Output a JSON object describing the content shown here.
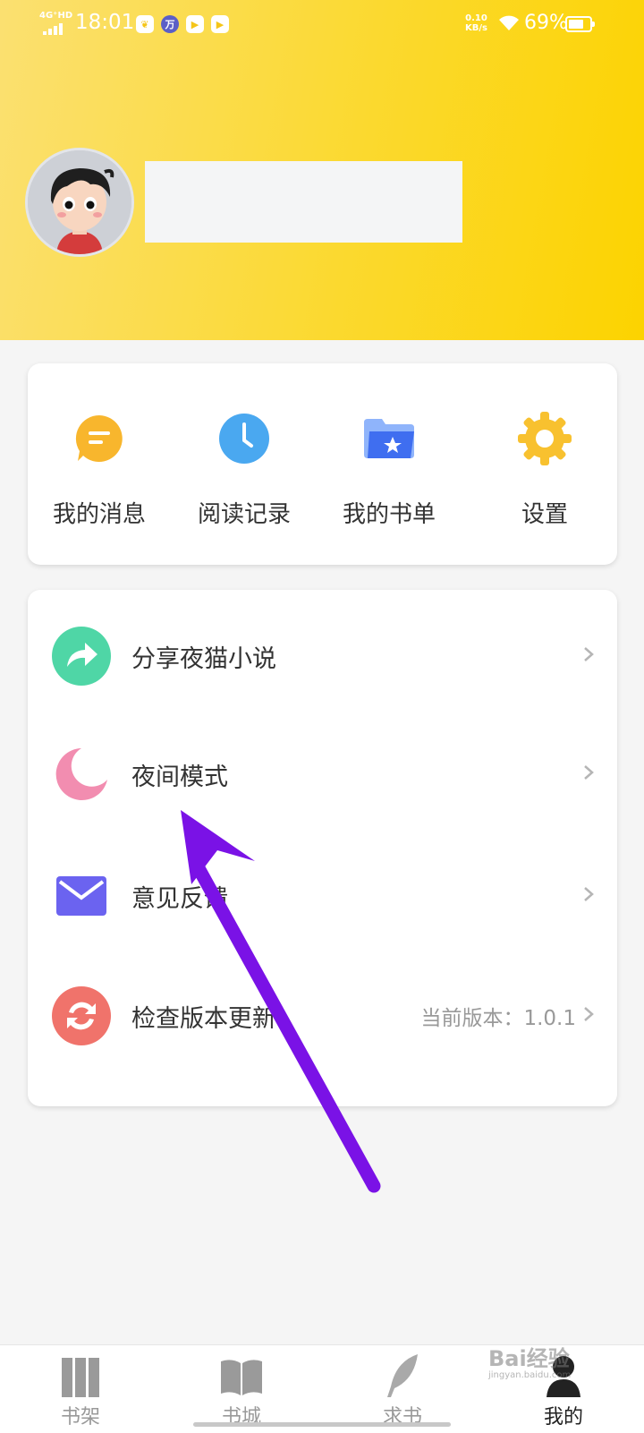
{
  "status_bar": {
    "network": "4G⁺HD",
    "time": "18:01",
    "app_icons": [
      "leaf-icon",
      "wan-icon",
      "play-icon",
      "play-icon"
    ],
    "speed_value": "0.10",
    "speed_unit": "KB/s",
    "battery": "69%"
  },
  "profile": {
    "avatar": "avatar"
  },
  "quick_actions": [
    {
      "label": "我的消息",
      "icon": "message-icon",
      "color": "#f8b62d"
    },
    {
      "label": "阅读记录",
      "icon": "clock-icon",
      "color": "#4aa8f0"
    },
    {
      "label": "我的书单",
      "icon": "folder-star-icon",
      "color": "#3f6ef0"
    },
    {
      "label": "设置",
      "icon": "gear-icon",
      "color": "#f8c12f"
    }
  ],
  "menu": [
    {
      "label": "分享夜猫小说",
      "value": "",
      "icon": "share-icon",
      "color": "#4fd6a6"
    },
    {
      "label": "夜间模式",
      "value": "",
      "icon": "moon-icon",
      "color": "#f28db0"
    },
    {
      "label": "意见反馈",
      "value": "",
      "icon": "mail-icon",
      "color": "#6b63f0"
    },
    {
      "label": "检查版本更新",
      "value": "当前版本：1.0.1",
      "icon": "refresh-icon",
      "color": "#f0736b"
    }
  ],
  "tabs": [
    {
      "label": "书架",
      "icon": "bookshelf-icon"
    },
    {
      "label": "书城",
      "icon": "open-book-icon"
    },
    {
      "label": "求书",
      "icon": "feather-icon"
    },
    {
      "label": "我的",
      "icon": "user-icon",
      "active": true
    }
  ],
  "annotation": {
    "color": "#7a12e6"
  },
  "watermark": {
    "text": "Bai经验",
    "sub": "jingyan.baidu.com"
  }
}
